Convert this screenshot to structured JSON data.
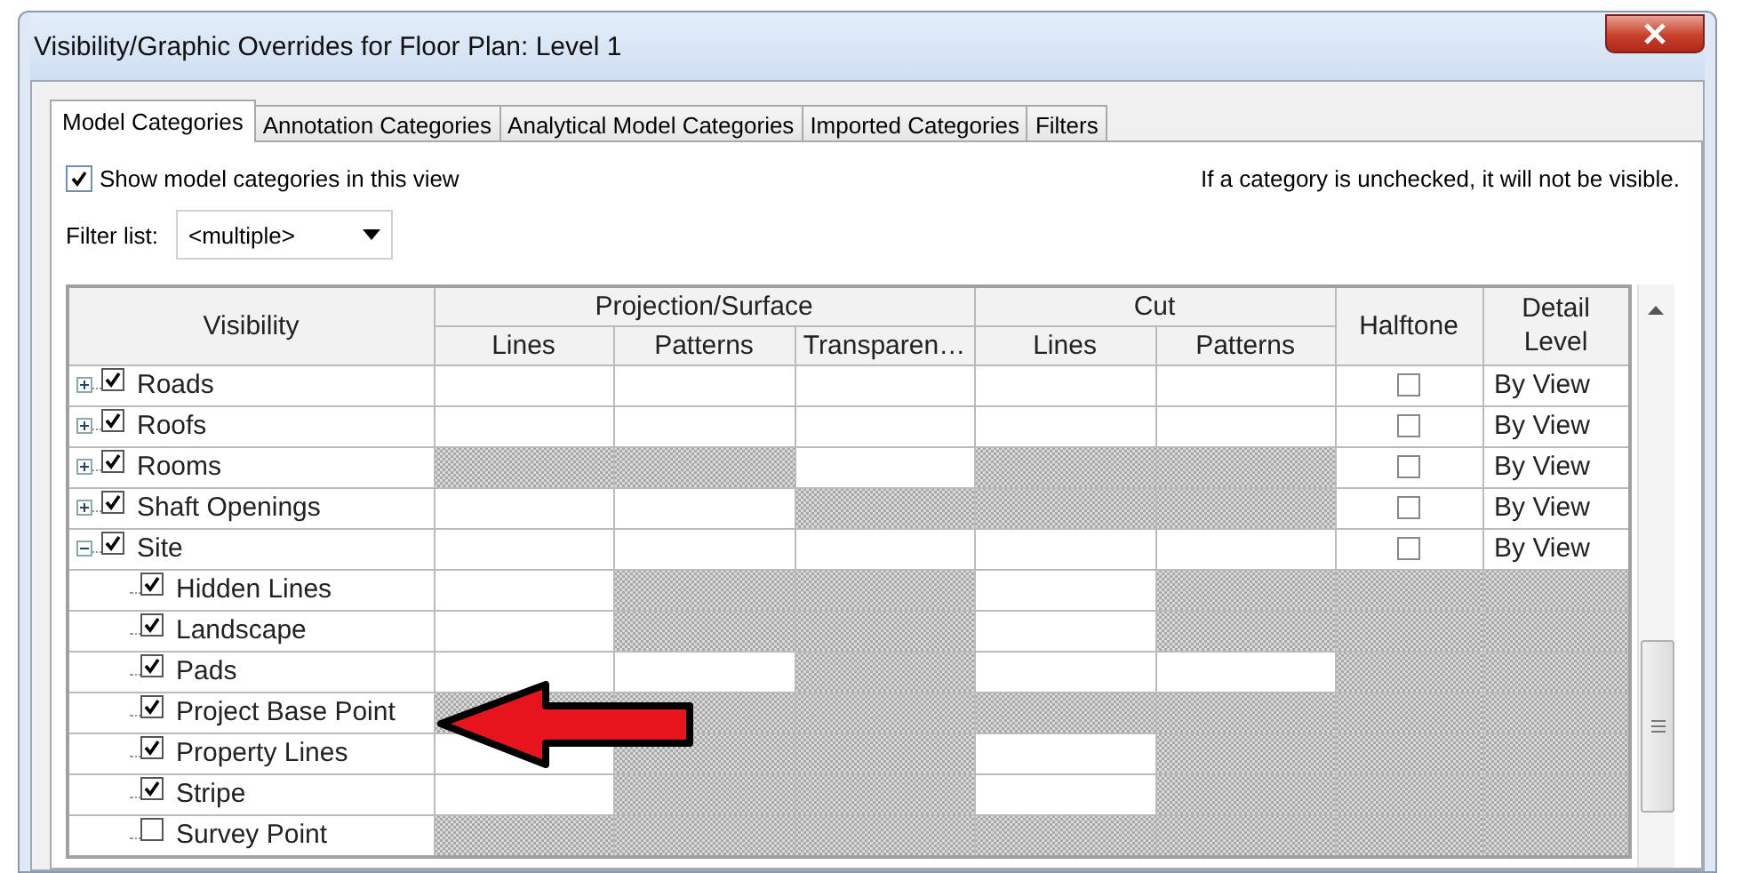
{
  "window": {
    "title": "Visibility/Graphic Overrides for Floor Plan: Level 1"
  },
  "tabs": [
    {
      "label": "Model Categories",
      "selected": true
    },
    {
      "label": "Annotation Categories",
      "selected": false
    },
    {
      "label": "Analytical Model Categories",
      "selected": false
    },
    {
      "label": "Imported Categories",
      "selected": false
    },
    {
      "label": "Filters",
      "selected": false
    }
  ],
  "show_categories": {
    "label": "Show model categories in this view",
    "checked": true
  },
  "hint": "If a category is unchecked, it will not be visible.",
  "filter_list": {
    "label": "Filter list:",
    "value": "<multiple>"
  },
  "table": {
    "visibility_header": "Visibility",
    "groups": [
      {
        "label": "Projection/Surface",
        "columns": [
          "Lines",
          "Patterns",
          "Transparen…"
        ]
      },
      {
        "label": "Cut",
        "columns": [
          "Lines",
          "Patterns"
        ]
      }
    ],
    "halftone_header": "Halftone",
    "detail_header": "Detail Level",
    "rows": [
      {
        "name": "Roads",
        "checked": true,
        "expanded": false,
        "hatched": [
          false,
          false,
          false,
          false,
          false,
          false,
          false
        ],
        "halftone": false,
        "detail_level": "By View"
      },
      {
        "name": "Roofs",
        "checked": true,
        "expanded": false,
        "hatched": [
          false,
          false,
          false,
          false,
          false,
          false,
          false
        ],
        "halftone": false,
        "detail_level": "By View"
      },
      {
        "name": "Rooms",
        "checked": true,
        "expanded": false,
        "hatched": [
          true,
          true,
          false,
          true,
          true,
          false,
          false
        ],
        "halftone": false,
        "detail_level": "By View"
      },
      {
        "name": "Shaft Openings",
        "checked": true,
        "expanded": false,
        "hatched": [
          false,
          false,
          true,
          true,
          true,
          false,
          false
        ],
        "halftone": false,
        "detail_level": "By View"
      },
      {
        "name": "Site",
        "checked": true,
        "expanded": true,
        "hatched": [
          false,
          false,
          false,
          false,
          false,
          false,
          false
        ],
        "halftone": false,
        "detail_level": "By View",
        "children": [
          {
            "name": "Hidden Lines",
            "checked": true,
            "hatched": [
              false,
              true,
              true,
              false,
              true,
              true,
              true
            ]
          },
          {
            "name": "Landscape",
            "checked": true,
            "hatched": [
              false,
              true,
              true,
              false,
              true,
              true,
              true
            ]
          },
          {
            "name": "Pads",
            "checked": true,
            "hatched": [
              false,
              false,
              true,
              false,
              false,
              true,
              true
            ]
          },
          {
            "name": "Project Base Point",
            "checked": true,
            "hatched": [
              true,
              true,
              true,
              true,
              true,
              true,
              true
            ]
          },
          {
            "name": "Property Lines",
            "checked": true,
            "hatched": [
              false,
              true,
              true,
              false,
              true,
              true,
              true
            ]
          },
          {
            "name": "Stripe",
            "checked": true,
            "hatched": [
              false,
              true,
              true,
              false,
              true,
              true,
              true
            ]
          },
          {
            "name": "Survey Point",
            "checked": false,
            "hatched": [
              true,
              true,
              true,
              true,
              true,
              true,
              true
            ]
          }
        ]
      }
    ]
  }
}
